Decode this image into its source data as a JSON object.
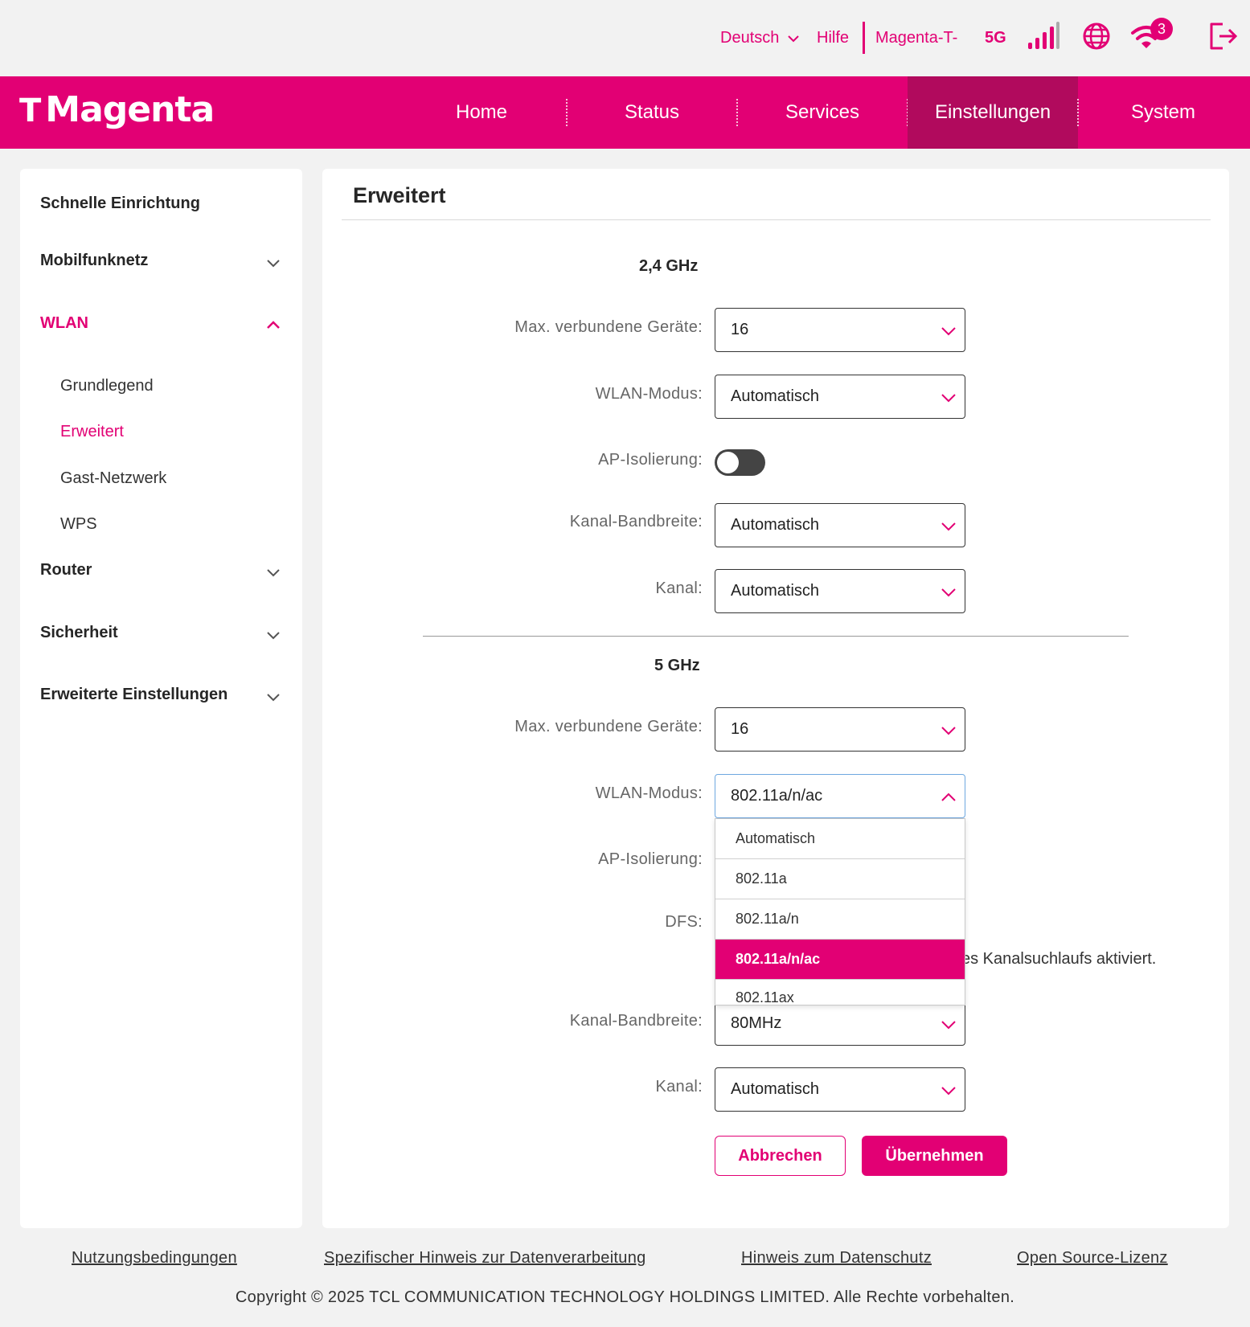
{
  "topbar": {
    "language": "Deutsch",
    "help": "Hilfe",
    "network_name": "Magenta-T-",
    "network_type": "5G",
    "wifi_clients_badge": "3"
  },
  "header": {
    "logo_mark": "T",
    "logo_text": "Magenta",
    "nav": [
      "Home",
      "Status",
      "Services",
      "Einstellungen",
      "System"
    ],
    "active_nav": "Einstellungen"
  },
  "sidebar": {
    "quick_setup": "Schnelle Einrichtung",
    "mobile": "Mobilfunknetz",
    "wlan": "WLAN",
    "wlan_sub": [
      "Grundlegend",
      "Erweitert",
      "Gast-Netzwerk",
      "WPS"
    ],
    "router": "Router",
    "security": "Sicherheit",
    "advanced": "Erweiterte Einstellungen"
  },
  "panel": {
    "title": "Erweitert",
    "band24": {
      "title": "2,4 GHz",
      "max_devices_label": "Max. verbundene Geräte:",
      "max_devices_value": "16",
      "mode_label": "WLAN-Modus:",
      "mode_value": "Automatisch",
      "ap_isolation_label": "AP-Isolierung:",
      "ap_isolation_on": false,
      "bandwidth_label": "Kanal-Bandbreite:",
      "bandwidth_value": "Automatisch",
      "channel_label": "Kanal:",
      "channel_value": "Automatisch"
    },
    "band5": {
      "title": "5 GHz",
      "max_devices_label": "Max. verbundene Geräte:",
      "max_devices_value": "16",
      "mode_label": "WLAN-Modus:",
      "mode_value": "802.11a/n/ac",
      "mode_options": [
        "Automatisch",
        "802.11a",
        "802.11a/n",
        "802.11a/n/ac",
        "802.11ax"
      ],
      "ap_isolation_label": "AP-Isolierung:",
      "dfs_label": "DFS:",
      "dfs_partial_text": "es Kanalsuchlaufs aktiviert.",
      "bandwidth_label": "Kanal-Bandbreite:",
      "bandwidth_value": "80MHz",
      "channel_label": "Kanal:",
      "channel_value": "Automatisch"
    },
    "cancel": "Abbrechen",
    "apply": "Übernehmen"
  },
  "footer": {
    "links": [
      "Nutzungsbedingungen",
      "Spezifischer Hinweis zur Datenverarbeitung",
      "Hinweis zum Datenschutz",
      "Open Source-Lizenz"
    ],
    "copyright": "Copyright © 2025 TCL COMMUNICATION TECHNOLOGY HOLDINGS LIMITED. Alle Rechte vorbehalten."
  },
  "colors": {
    "brand": "#e20074",
    "nav_active": "#b10a5d",
    "background": "#f2f2f2"
  },
  "icons": [
    "chevron-down-icon",
    "chevron-up-icon",
    "signal-bars-icon",
    "globe-icon",
    "wifi-icon",
    "logout-icon"
  ]
}
